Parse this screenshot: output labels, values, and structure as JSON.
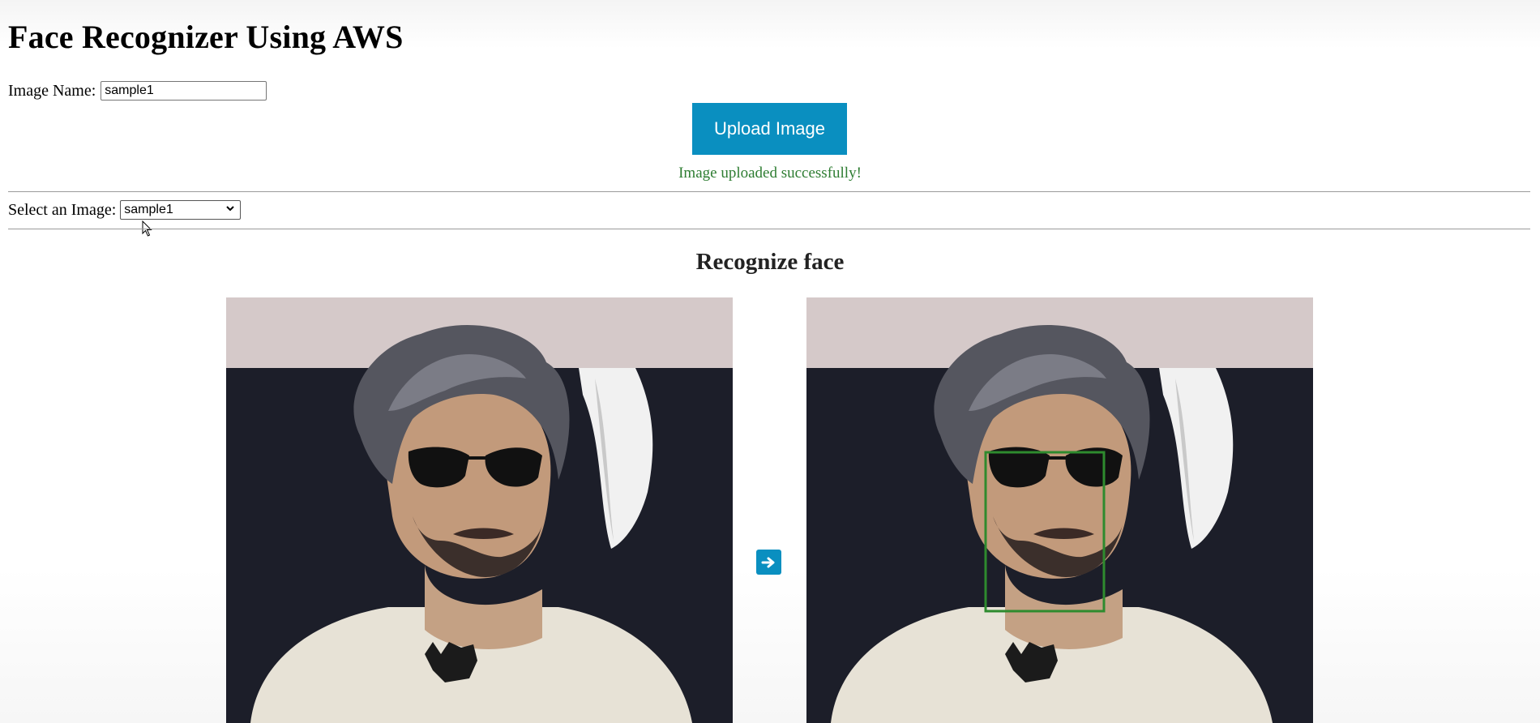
{
  "page": {
    "title": "Face Recognizer Using AWS"
  },
  "upload": {
    "image_name_label": "Image Name:",
    "image_name_value": "sample1",
    "button_label": "Upload Image",
    "status_message": "Image uploaded successfully!"
  },
  "selection": {
    "label": "Select an Image:",
    "selected_value": "sample1"
  },
  "recognize": {
    "heading": "Recognize face"
  },
  "colors": {
    "button": "#0a8fc0",
    "status_text": "#2e7d32",
    "face_box": "#2e8b2e"
  },
  "icons": {
    "arrow": "arrow-right-icon"
  }
}
